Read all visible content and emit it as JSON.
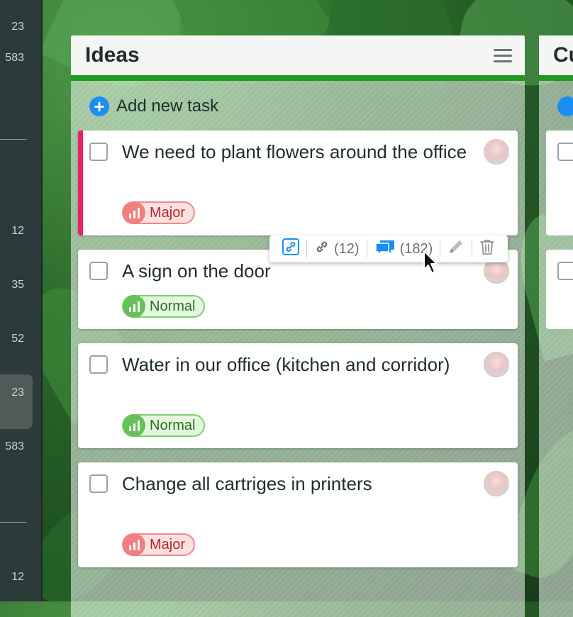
{
  "sidebar": {
    "numbers": [
      "23",
      "583",
      "12",
      "35",
      "52",
      "23",
      "583",
      "12"
    ]
  },
  "column": {
    "title": "Ideas",
    "add_task_label": "Add new task",
    "tasks": [
      {
        "title": "We need to plant flowers around the office",
        "priority": "Major"
      },
      {
        "title": "A sign on the door",
        "priority": "Normal"
      },
      {
        "title": "Water in our office (kitchen and corridor)",
        "priority": "Normal"
      },
      {
        "title": "Change all cartriges in printers",
        "priority": "Major"
      }
    ]
  },
  "toolbar": {
    "link_count": "(12)",
    "comment_count": "(182)"
  },
  "next_column": {
    "title": "Cu"
  },
  "colors": {
    "accent_green": "#1e9a1e",
    "major_red": "#f07f7f",
    "normal_green": "#68c05b",
    "urgent_stripe": "#ee1f6c",
    "add_blue": "#1a8ef2",
    "comment_blue": "#1a8ef2"
  },
  "icons": [
    "hamburger-menu-icon",
    "plus-icon",
    "priority-bars-icon",
    "copy-link-icon",
    "link-icon",
    "comments-icon",
    "pencil-icon",
    "trash-icon",
    "mouse-cursor-icon"
  ]
}
